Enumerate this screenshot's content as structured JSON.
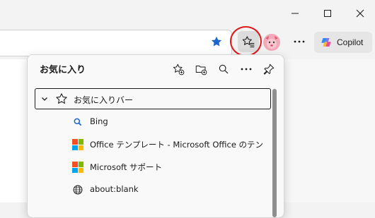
{
  "window_controls": {
    "minimize_icon": "minimize-icon",
    "maximize_icon": "maximize-icon",
    "close_icon": "close-icon"
  },
  "toolbar": {
    "copilot_label": "Copilot",
    "favorite_star_color": "#1a66c9",
    "highlight_ring_color": "#e0181b"
  },
  "favorites": {
    "title": "お気に入り",
    "folder": {
      "label": "お気に入りバー",
      "expanded": true
    },
    "items": [
      {
        "label": "Bing",
        "icon": "bing-search-icon"
      },
      {
        "label": "Office テンプレート - Microsoft Office のテンプ",
        "icon": "microsoft-logo-icon"
      },
      {
        "label": "Microsoft サポート",
        "icon": "microsoft-logo-icon"
      },
      {
        "label": "about:blank",
        "icon": "globe-icon"
      }
    ]
  }
}
